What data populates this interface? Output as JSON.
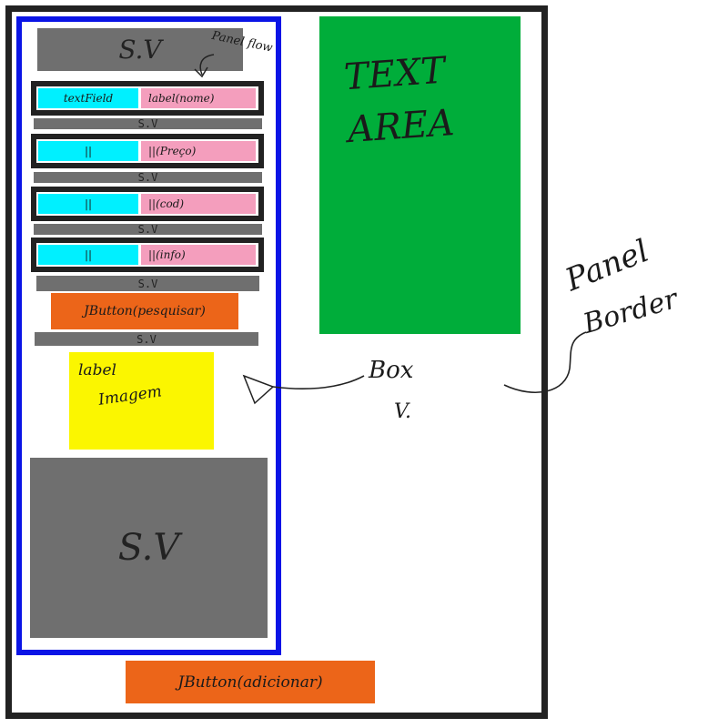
{
  "diagram": {
    "sv_label": "S.V",
    "panel_flow_note": "Panel flow",
    "rows": [
      {
        "left": "textField",
        "right": "label(nome)"
      },
      {
        "left": "||",
        "right": "||(Preço)"
      },
      {
        "left": "||",
        "right": "||(cod)"
      },
      {
        "left": "||",
        "right": "||(info)"
      }
    ],
    "text_area": "TEXT AREA",
    "button_pesquisar": "JButton(pesquisar)",
    "label_imagem_line1": "label",
    "label_imagem_line2": "Imagem",
    "box_v_line1": "Box",
    "box_v_line2": "V.",
    "panel_border_line1": "Panel",
    "panel_border_line2": "Border",
    "button_adicionar": "JButton(adicionar)"
  }
}
